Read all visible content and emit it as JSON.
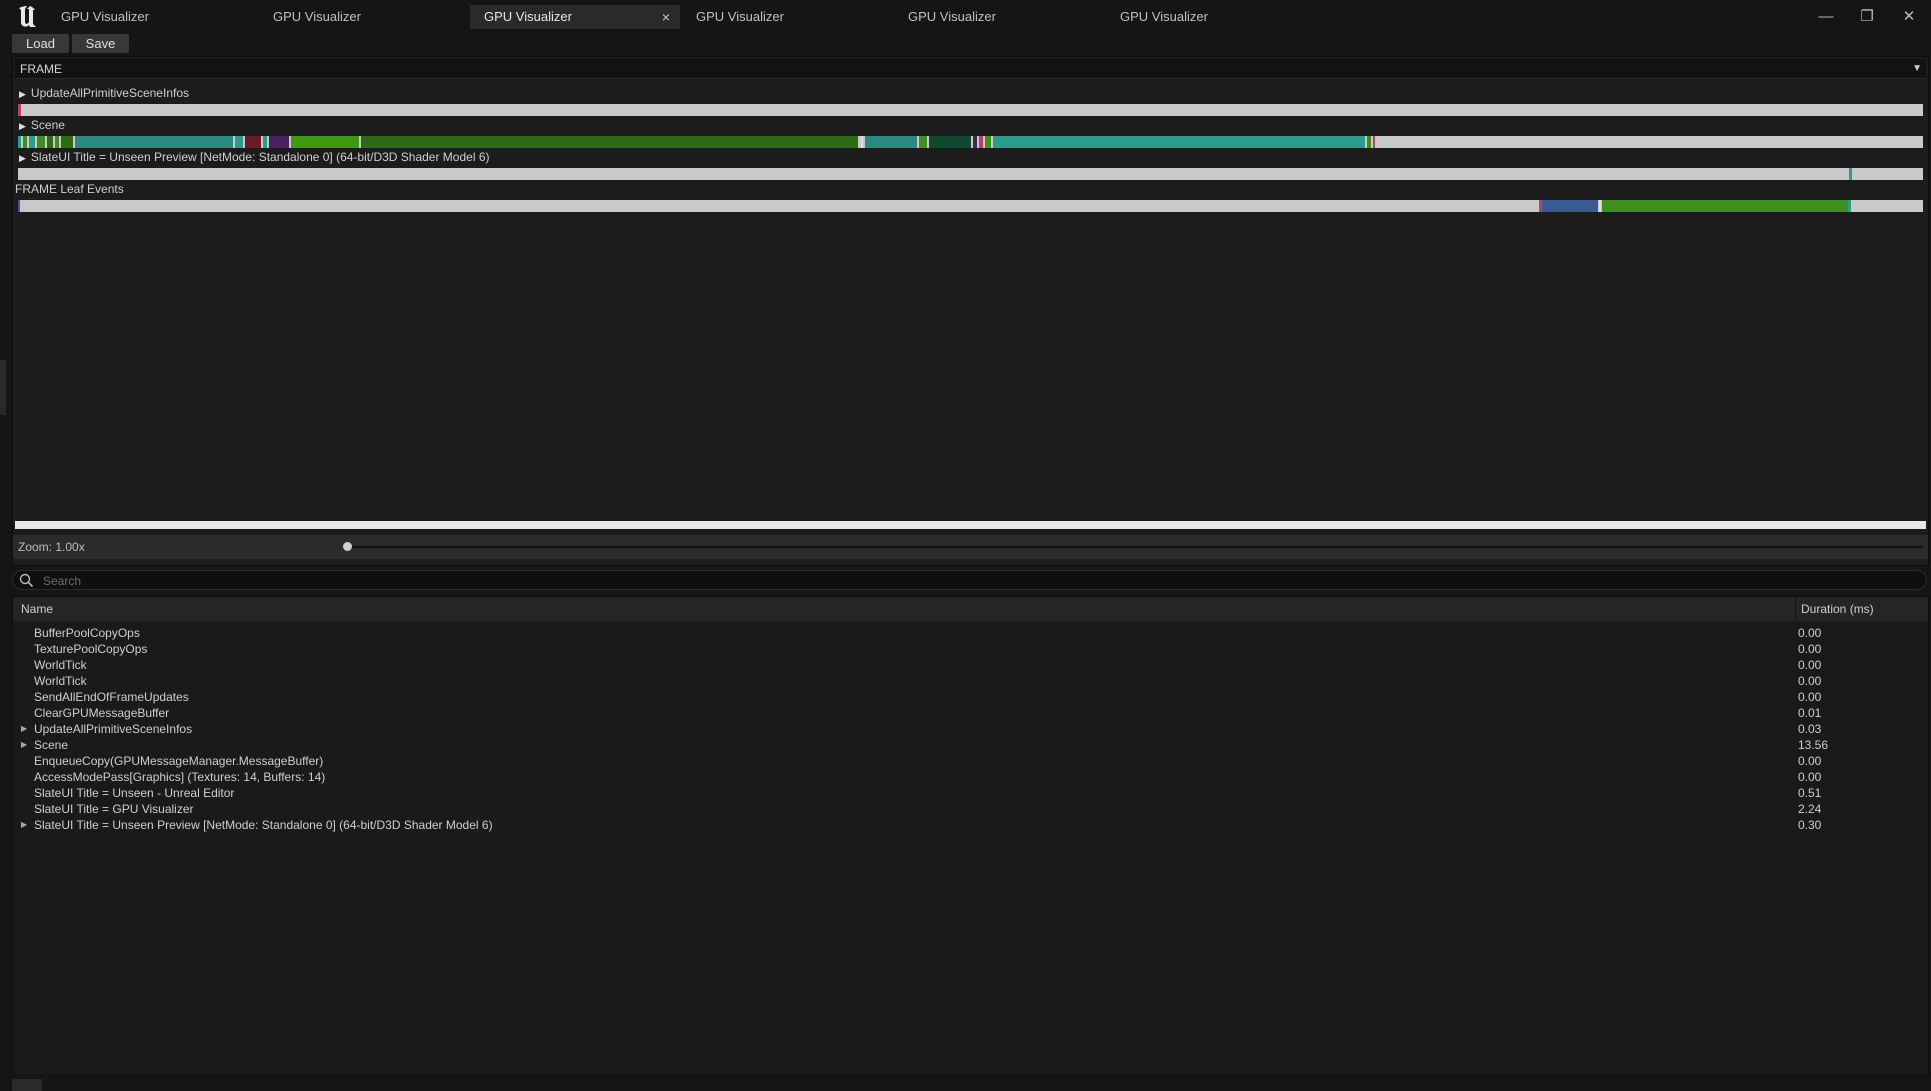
{
  "tabs": [
    {
      "label": "GPU Visualizer",
      "active": false
    },
    {
      "label": "GPU Visualizer",
      "active": false
    },
    {
      "label": "GPU Visualizer",
      "active": true
    },
    {
      "label": "GPU Visualizer",
      "active": false
    },
    {
      "label": "GPU Visualizer",
      "active": false
    },
    {
      "label": "GPU Visualizer",
      "active": false
    }
  ],
  "tab_close_glyph": "×",
  "window_controls": {
    "minimize": "—",
    "restore": "❐",
    "close": "✕"
  },
  "toolbar": {
    "load_label": "Load",
    "save_label": "Save"
  },
  "frame_select": {
    "value": "FRAME"
  },
  "tracks": [
    {
      "label": "UpdateAllPrimitiveSceneInfos",
      "expandable": true
    },
    {
      "label": "Scene",
      "expandable": true
    },
    {
      "label": "SlateUI Title = Unseen Preview [NetMode: Standalone 0]  (64-bit/D3D Shader Model 6)",
      "expandable": true
    },
    {
      "label": "FRAME Leaf Events",
      "expandable": false
    }
  ],
  "colors": {
    "teal": "#2a9d8f",
    "green": "#3f8f1f",
    "darkgreen": "#2d6b15",
    "blue": "#3a5a94",
    "maroon": "#6b1a2a",
    "purple": "#4a2160",
    "bar_bg": "#c9c9c9"
  },
  "zoom": {
    "label": "Zoom: 1.00x"
  },
  "search": {
    "placeholder": "Search",
    "icon": "search-icon"
  },
  "table": {
    "columns": {
      "name": "Name",
      "duration": "Duration (ms)"
    },
    "rows": [
      {
        "name": "BufferPoolCopyOps",
        "duration": "0.00",
        "expandable": false
      },
      {
        "name": "TexturePoolCopyOps",
        "duration": "0.00",
        "expandable": false
      },
      {
        "name": "WorldTick",
        "duration": "0.00",
        "expandable": false
      },
      {
        "name": "WorldTick",
        "duration": "0.00",
        "expandable": false
      },
      {
        "name": "SendAllEndOfFrameUpdates",
        "duration": "0.00",
        "expandable": false
      },
      {
        "name": "ClearGPUMessageBuffer",
        "duration": "0.01",
        "expandable": false
      },
      {
        "name": "UpdateAllPrimitiveSceneInfos",
        "duration": "0.03",
        "expandable": true
      },
      {
        "name": "Scene",
        "duration": "13.56",
        "expandable": true
      },
      {
        "name": "EnqueueCopy(GPUMessageManager.MessageBuffer)",
        "duration": "0.00",
        "expandable": false
      },
      {
        "name": "AccessModePass[Graphics] (Textures: 14, Buffers: 14)",
        "duration": "0.00",
        "expandable": false
      },
      {
        "name": "SlateUI Title = Unseen - Unreal Editor",
        "duration": "0.51",
        "expandable": false
      },
      {
        "name": "SlateUI Title = GPU Visualizer",
        "duration": "2.24",
        "expandable": false
      },
      {
        "name": "SlateUI Title = Unseen Preview [NetMode: Standalone 0]  (64-bit/D3D Shader Model 6)",
        "duration": "0.30",
        "expandable": true
      }
    ]
  }
}
